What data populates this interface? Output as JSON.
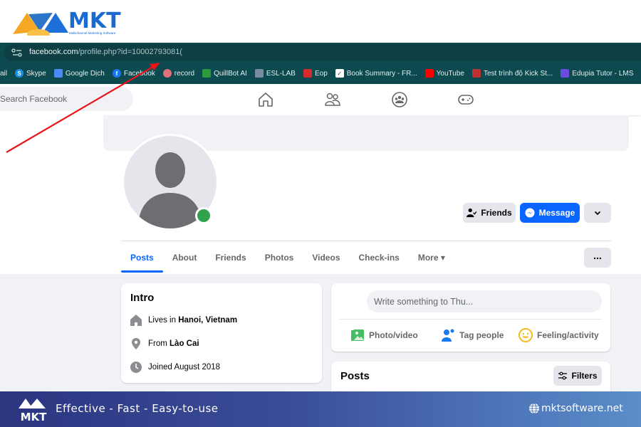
{
  "branding": {
    "logo_text": "MKT",
    "logo_subtitle": "Multichannel Marketing Software",
    "footer_slogan": "Effective - Fast - Easy-to-use",
    "footer_site": "mktsoftware.net",
    "footer_logo_text": "MKT"
  },
  "browser": {
    "url_host": "facebook.com",
    "url_path": "/profile.php?id=10002793081(",
    "bookmarks": [
      {
        "label": "ail",
        "icon": "gmail-icon",
        "color": ""
      },
      {
        "label": "Skype",
        "icon": "skype-icon",
        "color": "#1a8ee0"
      },
      {
        "label": "Google Dịch",
        "icon": "google-translate-icon",
        "color": "#4a8af4"
      },
      {
        "label": "Facebook",
        "icon": "facebook-icon",
        "color": "#1877f2"
      },
      {
        "label": "record",
        "icon": "record-icon",
        "color": "#e0707a"
      },
      {
        "label": "QuillBot AI",
        "icon": "quillbot-icon",
        "color": "#2e9a3e"
      },
      {
        "label": "ESL-LAB",
        "icon": "esl-lab-icon",
        "color": "#7a8aa0"
      },
      {
        "label": "Eop",
        "icon": "eop-icon",
        "color": "#d62b2b"
      },
      {
        "label": "Book Summary - FR...",
        "icon": "checkbox-icon",
        "color": "#ffffff"
      },
      {
        "label": "YouTube",
        "icon": "youtube-icon",
        "color": "#ff0000"
      },
      {
        "label": "Test trình độ Kick St...",
        "icon": "kickstart-icon",
        "color": "#c03030"
      },
      {
        "label": "Edupia Tutor - LMS",
        "icon": "edupia-icon",
        "color": "#6a4ce0"
      }
    ]
  },
  "facebook": {
    "search_placeholder": "Search Facebook",
    "nav_icons": [
      "home-icon",
      "friends-icon",
      "groups-icon",
      "gaming-icon"
    ],
    "buttons": {
      "friends": "Friends",
      "message": "Message",
      "more_options": "..."
    },
    "tabs": [
      {
        "label": "Posts",
        "active": true
      },
      {
        "label": "About",
        "active": false
      },
      {
        "label": "Friends",
        "active": false
      },
      {
        "label": "Photos",
        "active": false
      },
      {
        "label": "Videos",
        "active": false
      },
      {
        "label": "Check-ins",
        "active": false
      },
      {
        "label": "More ▾",
        "active": false
      }
    ],
    "intro": {
      "title": "Intro",
      "lives_prefix": "Lives in ",
      "lives_value": "Hanoi, Vietnam",
      "from_prefix": "From ",
      "from_value": "Lào Cai",
      "joined": "Joined August 2018"
    },
    "composer": {
      "placeholder": "Write something to Thu...",
      "actions": [
        {
          "label": "Photo/video",
          "icon": "photo-video-icon"
        },
        {
          "label": "Tag people",
          "icon": "tag-people-icon"
        },
        {
          "label": "Feeling/activity",
          "icon": "feeling-icon"
        }
      ]
    },
    "posts": {
      "title": "Posts",
      "filters_label": "Filters"
    },
    "status": {
      "online": true,
      "online_color": "#31a24c"
    }
  }
}
